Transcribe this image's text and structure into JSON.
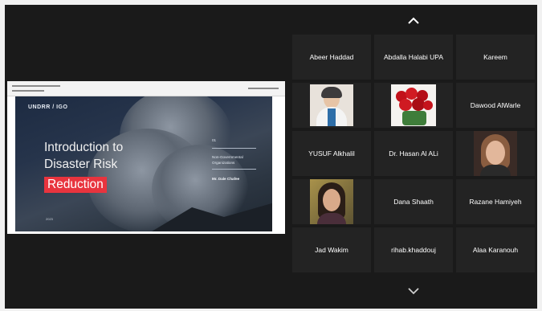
{
  "shared_slide": {
    "logo_text": "UNDRR / IGO",
    "title_line1": "Introduction to",
    "title_line2": "Disaster Risk",
    "title_highlight": "Reduction",
    "side_number": "01",
    "side_line1": "Non-Governmental",
    "side_line2": "Organizations",
    "side_author": "Mr. Dale Chafee",
    "date_text": "2023"
  },
  "participants": [
    {
      "name": "Abeer Haddad",
      "video": false
    },
    {
      "name": "Abdalla Halabi UPA",
      "video": false
    },
    {
      "name": "Kareem",
      "video": false
    },
    {
      "name": "",
      "video": true,
      "icon": "woman-hijab-photo"
    },
    {
      "name": "",
      "video": true,
      "icon": "red-roses-photo"
    },
    {
      "name": "Dawood AlWarle",
      "video": false
    },
    {
      "name": "YUSUF Alkhalil",
      "video": false
    },
    {
      "name": "Dr. Hasan Al ALi",
      "video": false
    },
    {
      "name": "",
      "video": true,
      "icon": "woman-portrait-photo"
    },
    {
      "name": "",
      "video": true,
      "icon": "woman-smiling-photo"
    },
    {
      "name": "Dana Shaath",
      "video": false
    },
    {
      "name": "Razane Hamiyeh",
      "video": false
    },
    {
      "name": "Jad Wakim",
      "video": false
    },
    {
      "name": "rihab.khaddouj",
      "video": false
    },
    {
      "name": "Alaa Karanouh",
      "video": false
    }
  ],
  "colors": {
    "background": "#1a1a1a",
    "tile": "#232323",
    "highlight": "#e8343e"
  }
}
